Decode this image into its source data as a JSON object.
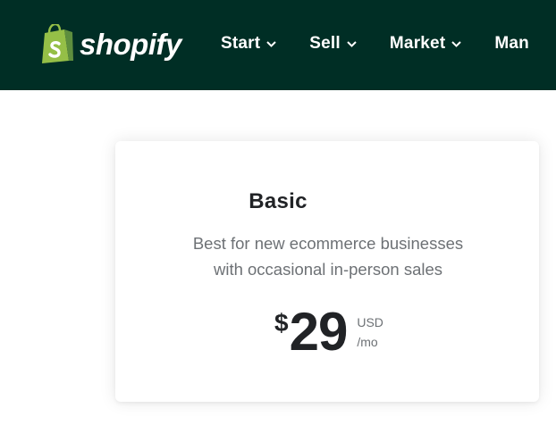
{
  "header": {
    "brand": "shopify",
    "nav": [
      {
        "label": "Start"
      },
      {
        "label": "Sell"
      },
      {
        "label": "Market"
      },
      {
        "label": "Man"
      }
    ]
  },
  "plan": {
    "name": "Basic",
    "description_line1": "Best for new ecommerce businesses",
    "description_line2": "with occasional in-person sales",
    "currency_symbol": "$",
    "amount": "29",
    "currency": "USD",
    "period": "/mo"
  },
  "colors": {
    "header_bg": "#002e25",
    "logo_green": "#95bf47",
    "logo_dark_green": "#5e8e3e",
    "text_dark": "#212326",
    "text_muted": "#6d7175"
  }
}
